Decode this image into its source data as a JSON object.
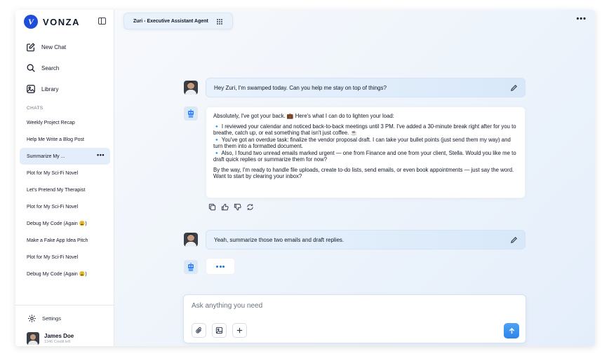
{
  "brand": {
    "name": "VONZA",
    "mark": "V"
  },
  "sidebar": {
    "nav": [
      {
        "label": "New Chat",
        "icon": "edit-icon"
      },
      {
        "label": "Search",
        "icon": "search-icon"
      },
      {
        "label": "Library",
        "icon": "image-icon"
      }
    ],
    "section_label": "CHATS",
    "chats": [
      {
        "label": "Weekly Project Recap"
      },
      {
        "label": "Help Me Write a Blog Post"
      },
      {
        "label": "Summarize My ...",
        "active": true
      },
      {
        "label": "Plot for My Sci-Fi Novel"
      },
      {
        "label": "Let's Pretend My Therapist"
      },
      {
        "label": "Plot for My Sci-Fi Novel"
      },
      {
        "label": "Debug My Code (Again 😩)"
      },
      {
        "label": "Make a Fake App Idea Pitch"
      },
      {
        "label": "Plot for My Sci-Fi Novel"
      },
      {
        "label": "Debug My Code (Again 😩)"
      }
    ],
    "more": "•••",
    "settings_label": "Settings",
    "user": {
      "name": "James Doe",
      "credits": "1346 Credit left"
    }
  },
  "header": {
    "agent_name": "Zuri - Executive Assistant Agent",
    "more": "•••"
  },
  "messages": {
    "user1": "Hey Zuri, I'm swamped today. Can you help me stay on top of things?",
    "bot1": {
      "p1": "Absolutely, I've got your back. 💼 Here's what I can do to lighten your load:",
      "p2a": "🔹 I reviewed your calendar and noticed back-to-back meetings until 3 PM. I've added a 30-minute break right after for you to breathe, catch up, or eat something that isn't just coffee. ☕",
      "p2b": "🔹 You've got an overdue task: finalize the vendor proposal draft. I can take your bullet points (just send them my way) and turn them into a formatted document.",
      "p2c": "🔹 Also, I found two unread emails marked urgent — one from Finance and one from your client, Stella. Would you like me to draft quick replies or summarize them for now?",
      "p3a": "By the way, I'm ready to handle file uploads, create to-do lists, send emails, or even book appointments — just say the word.",
      "p3b": "Want to start by clearing your inbox?"
    },
    "user2": "Yeah, summarize those two emails and draft replies."
  },
  "composer": {
    "placeholder": "Ask anything you need"
  },
  "colors": {
    "accent": "#2b84ea",
    "brand": "#1e4ed8",
    "user_bubble": "#dceafa"
  }
}
